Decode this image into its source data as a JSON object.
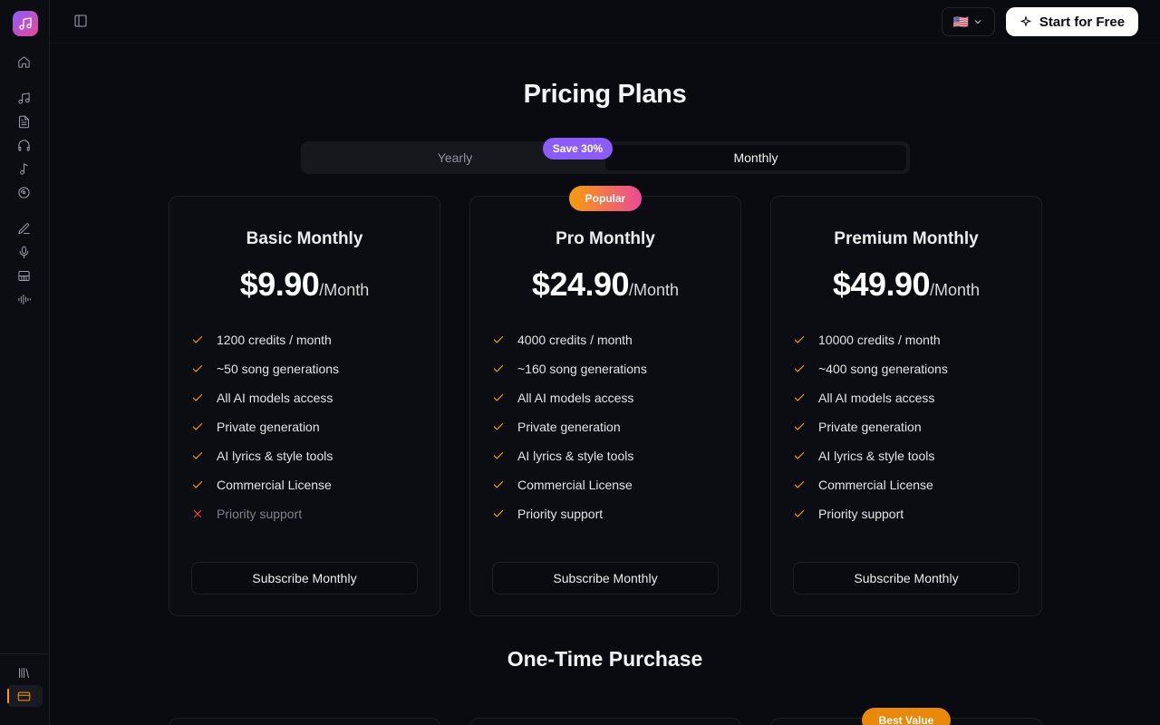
{
  "topbar": {
    "language_flag": "🇺🇸",
    "start_label": "Start for Free"
  },
  "sidebar": {
    "items": [
      {
        "name": "home-icon"
      },
      {
        "name": "music-note-icon"
      },
      {
        "name": "document-icon"
      },
      {
        "name": "headphones-icon"
      },
      {
        "name": "single-note-icon"
      },
      {
        "name": "disc-icon"
      },
      {
        "name": "pen-icon"
      },
      {
        "name": "microphone-icon"
      },
      {
        "name": "piano-icon"
      },
      {
        "name": "waveform-icon"
      },
      {
        "name": "library-icon"
      },
      {
        "name": "credit-card-icon",
        "active": true
      }
    ]
  },
  "main": {
    "title": "Pricing Plans",
    "billing": {
      "yearly_label": "Yearly",
      "monthly_label": "Monthly",
      "save_badge": "Save 30%",
      "selected": "Monthly"
    },
    "popular_badge": "Popular",
    "plans": [
      {
        "name": "Basic Monthly",
        "price": "$9.90",
        "period": "/Month",
        "features": [
          {
            "text": "1200 credits / month",
            "included": true
          },
          {
            "text": "~50 song generations",
            "included": true
          },
          {
            "text": "All AI models access",
            "included": true
          },
          {
            "text": "Private generation",
            "included": true
          },
          {
            "text": "AI lyrics & style tools",
            "included": true
          },
          {
            "text": "Commercial License",
            "included": true
          },
          {
            "text": "Priority support",
            "included": false
          }
        ],
        "button": "Subscribe Monthly"
      },
      {
        "name": "Pro Monthly",
        "price": "$24.90",
        "period": "/Month",
        "features": [
          {
            "text": "4000 credits / month",
            "included": true
          },
          {
            "text": "~160 song generations",
            "included": true
          },
          {
            "text": "All AI models access",
            "included": true
          },
          {
            "text": "Private generation",
            "included": true
          },
          {
            "text": "AI lyrics & style tools",
            "included": true
          },
          {
            "text": "Commercial License",
            "included": true
          },
          {
            "text": "Priority support",
            "included": true
          }
        ],
        "button": "Subscribe Monthly"
      },
      {
        "name": "Premium Monthly",
        "price": "$49.90",
        "period": "/Month",
        "features": [
          {
            "text": "10000 credits / month",
            "included": true
          },
          {
            "text": "~400 song generations",
            "included": true
          },
          {
            "text": "All AI models access",
            "included": true
          },
          {
            "text": "Private generation",
            "included": true
          },
          {
            "text": "AI lyrics & style tools",
            "included": true
          },
          {
            "text": "Commercial License",
            "included": true
          },
          {
            "text": "Priority support",
            "included": true
          }
        ],
        "button": "Subscribe Monthly"
      }
    ],
    "one_time_title": "One-Time Purchase",
    "best_value_badge": "Best Value"
  },
  "colors": {
    "check": "#f59e0b",
    "cross": "#ef4444",
    "accent_purple": "#8b5cf6",
    "accent_pink": "#ec4899"
  }
}
